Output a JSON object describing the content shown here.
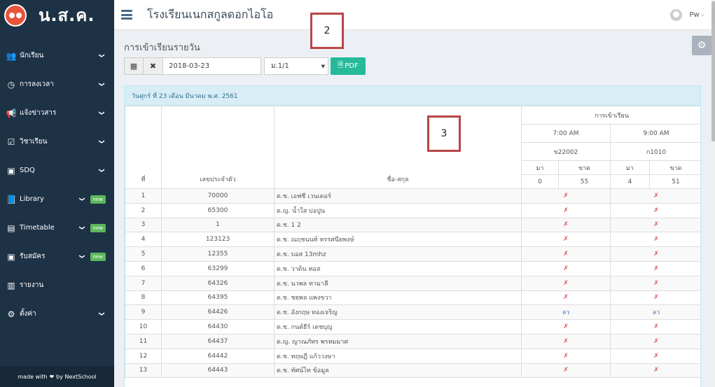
{
  "brand": {
    "name": "น.ส.ค."
  },
  "sidebar": {
    "items": [
      {
        "icon": "users-icon",
        "glyph": "👥",
        "label": "นักเรียน",
        "chevron": true,
        "badge": ""
      },
      {
        "icon": "clock-icon",
        "glyph": "◷",
        "label": "การลงเวลา",
        "chevron": true,
        "badge": ""
      },
      {
        "icon": "bullhorn-icon",
        "glyph": "📢",
        "label": "แจ้งข่าวสาร",
        "chevron": true,
        "badge": ""
      },
      {
        "icon": "calendar-check-icon",
        "glyph": "☑",
        "label": "วิชาเรียน",
        "chevron": true,
        "badge": ""
      },
      {
        "icon": "sdq-icon",
        "glyph": "▣",
        "label": "SDQ",
        "chevron": true,
        "badge": ""
      },
      {
        "icon": "book-icon",
        "glyph": "📘",
        "label": "Library",
        "chevron": true,
        "badge": "new"
      },
      {
        "icon": "timetable-icon",
        "glyph": "▤",
        "label": "Timetable",
        "chevron": true,
        "badge": "new"
      },
      {
        "icon": "register-icon",
        "glyph": "▣",
        "label": "รับสมัคร",
        "chevron": true,
        "badge": "new"
      },
      {
        "icon": "bar-chart-icon",
        "glyph": "▥",
        "label": "รายงาน",
        "chevron": false,
        "badge": ""
      },
      {
        "icon": "gears-icon",
        "glyph": "⚙",
        "label": "ตั้งค่า",
        "chevron": true,
        "badge": ""
      }
    ],
    "footer_pre": "made with",
    "footer_post": "by NextSchool"
  },
  "header": {
    "school_name": "โรงเรียนเนกสกูลดอกไอโอ",
    "user": "Pw"
  },
  "page": {
    "title": "การเข้าเรียนรายวัน",
    "date_value": "2018-03-23",
    "class_select": "ม.1/1",
    "pdf_label": "PDF",
    "panel_heading": "วันศุกร์ ที่ 23 เดือน มีนาคม พ.ศ. 2561"
  },
  "table": {
    "col_no": "ที่",
    "col_id": "เลขประจำตัว",
    "col_name": "ชื่อ-สกุล",
    "group_header": "การเข้าเรียน",
    "sessions": [
      {
        "time": "7:00 AM",
        "subject": "ข22002",
        "present_label": "มา",
        "absent_label": "ขาด",
        "present": "0",
        "absent": "55"
      },
      {
        "time": "9:00 AM",
        "subject": "ก1010",
        "present_label": "มา",
        "absent_label": "ขาด",
        "present": "4",
        "absent": "51"
      }
    ],
    "rows": [
      {
        "no": "1",
        "id": "70000",
        "name": "ด.ช. เอฟซี เวนเดอร์",
        "s1": "✗",
        "s2": "✗"
      },
      {
        "no": "2",
        "id": "65300",
        "name": "ด.ญ. น้ำใส บ่อปูน",
        "s1": "✗",
        "s2": "✗"
      },
      {
        "no": "3",
        "id": "1",
        "name": "ด.ช. 1 2",
        "s1": "✗",
        "s2": "✗"
      },
      {
        "no": "4",
        "id": "123123",
        "name": "ด.ช. ณฤชนนท์ ทรรศนียพงษ์",
        "s1": "✗",
        "s2": "✗"
      },
      {
        "no": "5",
        "id": "12355",
        "name": "ด.ช. บอส 13mhz",
        "s1": "✗",
        "s2": "✗"
      },
      {
        "no": "6",
        "id": "63299",
        "name": "ด.ช. วาดิน ทอส",
        "s1": "✗",
        "s2": "✗"
      },
      {
        "no": "7",
        "id": "64326",
        "name": "ด.ช. นวพล ทามาลี",
        "s1": "✗",
        "s2": "✗"
      },
      {
        "no": "8",
        "id": "64395",
        "name": "ด.ช. ชยพล แพงขวา",
        "s1": "✗",
        "s2": "✗"
      },
      {
        "no": "9",
        "id": "64426",
        "name": "ด.ช. อังกฤษ ทองเจริญ",
        "s1": "ลว",
        "s2": "ลว"
      },
      {
        "no": "10",
        "id": "64430",
        "name": "ด.ช. กนต์ธีร์ เดชบุญ",
        "s1": "✗",
        "s2": "✗"
      },
      {
        "no": "11",
        "id": "64437",
        "name": "ด.ญ. ญาณภัทร พรหมมาศ",
        "s1": "✗",
        "s2": "✗"
      },
      {
        "no": "12",
        "id": "64442",
        "name": "ด.ช. ทฤษฎี แก้ววงษา",
        "s1": "✗",
        "s2": "✗"
      },
      {
        "no": "13",
        "id": "64443",
        "name": "ด.ช. ทัศน์ไท ข้อมูล",
        "s1": "✗",
        "s2": "✗"
      }
    ]
  },
  "annotations": {
    "box2": "2",
    "box3": "3"
  }
}
